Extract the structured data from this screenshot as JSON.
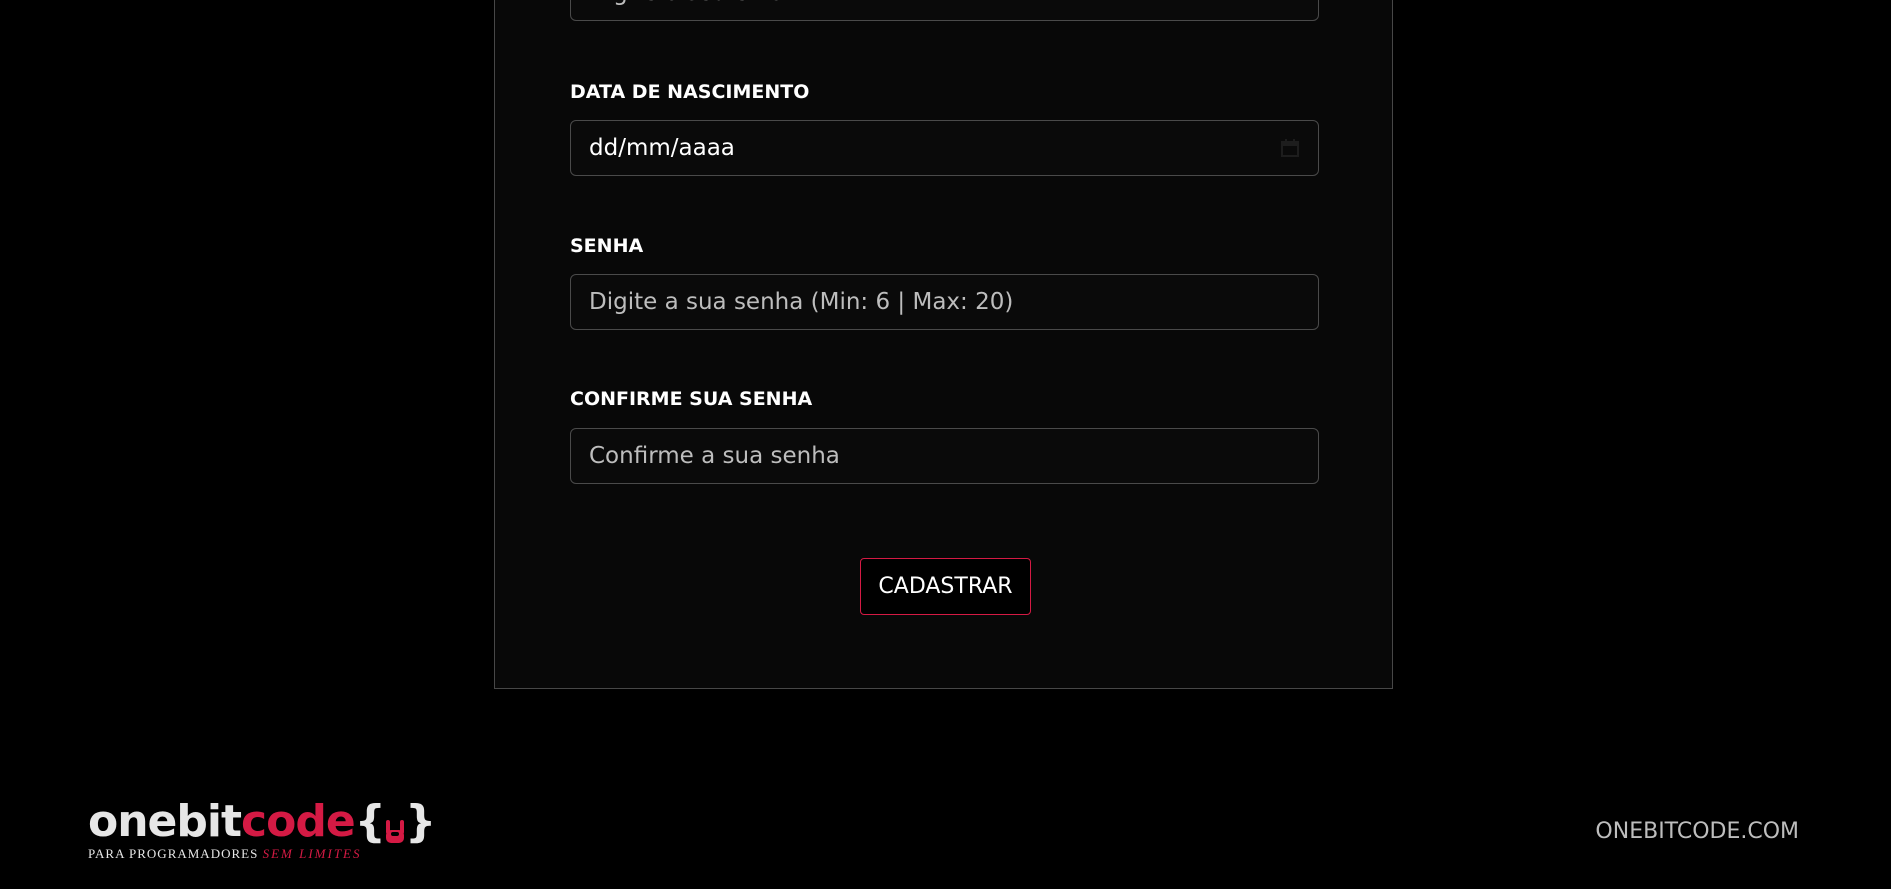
{
  "form": {
    "email_placeholder": "Digite o seu email",
    "birthdate_label": "DATA DE NASCIMENTO",
    "birthdate_value": "dd/mm/aaaa",
    "password_label": "SENHA",
    "password_placeholder": "Digite a sua senha (Min: 6 | Max: 20)",
    "confirm_label": "CONFIRME SUA SENHA",
    "confirm_placeholder": "Confirme a sua senha",
    "submit_label": "CADASTRAR"
  },
  "footer": {
    "logo_part_one": "onebit",
    "logo_part_two": "code",
    "logo_open_brace": "{",
    "logo_close_brace": "}",
    "tagline_a": "PARA PROGRAMADORES",
    "tagline_b": "SEM LIMITES",
    "link_label": "ONEBITCODE.COM"
  },
  "icons": {
    "calendar": "calendar-icon",
    "logo_hand": "rock-hand-icon"
  },
  "colors": {
    "accent": "#d41a44",
    "background": "#000000",
    "card": "#080808",
    "border": "#474747"
  }
}
